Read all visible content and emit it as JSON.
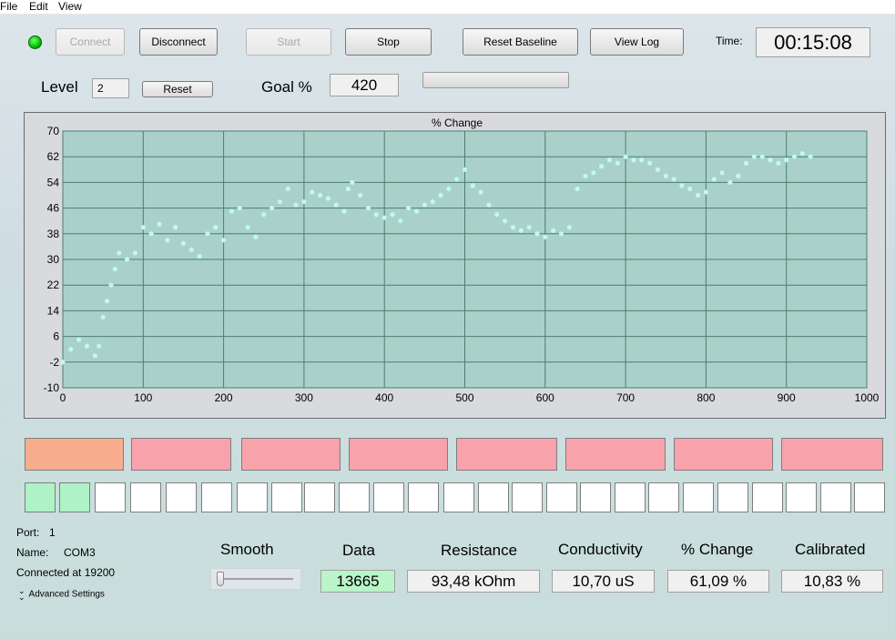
{
  "menu": {
    "file": "File",
    "edit": "Edit",
    "view": "View"
  },
  "toolbar": {
    "connect": "Connect",
    "disconnect": "Disconnect",
    "start": "Start",
    "stop": "Stop",
    "reset_baseline": "Reset Baseline",
    "view_log": "View Log",
    "time_label": "Time:",
    "time_value": "00:15:08"
  },
  "level": {
    "label": "Level",
    "value": "2",
    "reset": "Reset"
  },
  "goal": {
    "label": "Goal %",
    "value": "420",
    "progress": 0
  },
  "chart_data": {
    "type": "scatter",
    "title": "% Change",
    "xlabel": "",
    "ylabel": "",
    "xlim": [
      0,
      1000
    ],
    "ylim": [
      -10,
      70
    ],
    "x_ticks": [
      "0",
      "100",
      "200",
      "300",
      "400",
      "500",
      "600",
      "700",
      "800",
      "900",
      "1000"
    ],
    "y_ticks": [
      "70",
      "62",
      "54",
      "46",
      "38",
      "30",
      "22",
      "14",
      "6",
      "-2",
      "-10"
    ],
    "grid": true,
    "legend": "none",
    "series": [
      {
        "color": "#bff8f4",
        "x": [
          0,
          10,
          20,
          30,
          40,
          45,
          50,
          55,
          60,
          65,
          70,
          80,
          90,
          100,
          110,
          120,
          130,
          140,
          150,
          160,
          170,
          180,
          190,
          200,
          210,
          220,
          230,
          240,
          250,
          260,
          270,
          280,
          290,
          300,
          310,
          320,
          330,
          340,
          350,
          355,
          360,
          370,
          380,
          390,
          400,
          410,
          420,
          430,
          440,
          450,
          460,
          470,
          480,
          490,
          500,
          510,
          520,
          530,
          540,
          550,
          560,
          570,
          580,
          590,
          600,
          610,
          620,
          630,
          640,
          650,
          660,
          670,
          680,
          690,
          700,
          710,
          720,
          730,
          740,
          750,
          760,
          770,
          780,
          790,
          800,
          810,
          820,
          830,
          840,
          850,
          860,
          870,
          880,
          890,
          900,
          910,
          920,
          930
        ],
        "y": [
          -2,
          2,
          5,
          3,
          0,
          3,
          12,
          17,
          22,
          27,
          32,
          30,
          32,
          40,
          38,
          41,
          36,
          40,
          35,
          33,
          31,
          38,
          40,
          36,
          45,
          46,
          40,
          37,
          44,
          46,
          48,
          52,
          47,
          48,
          51,
          50,
          49,
          47,
          45,
          52,
          54,
          50,
          46,
          44,
          43,
          44,
          42,
          46,
          45,
          47,
          48,
          50,
          52,
          55,
          58,
          53,
          51,
          47,
          44,
          42,
          40,
          39,
          40,
          38,
          37,
          39,
          38,
          40,
          52,
          56,
          57,
          59,
          61,
          60,
          62,
          61,
          61,
          60,
          58,
          56,
          55,
          53,
          52,
          50,
          51,
          55,
          57,
          54,
          56,
          60,
          62,
          62,
          61,
          60,
          61,
          62,
          63,
          62
        ]
      }
    ]
  },
  "zones": [
    "",
    "",
    "",
    "",
    "",
    "",
    "",
    ""
  ],
  "device": {
    "port_label": "Port:",
    "port_value": "1",
    "name_label": "Name:",
    "name_value": "COM3",
    "connected": "Connected at 19200",
    "advanced": "Advanced Settings"
  },
  "smooth": {
    "label": "Smooth",
    "value": 0
  },
  "readouts": {
    "data_label": "Data",
    "data_value": "13665",
    "resistance_label": "Resistance",
    "resistance_value": "93,48 kOhm",
    "conductivity_label": "Conductivity",
    "conductivity_value": "10,70 uS",
    "change_label": "% Change",
    "change_value": "61,09 %",
    "calibrated_label": "Calibrated",
    "calibrated_value": "10,83 %"
  },
  "colors": {
    "plot_bg": "#a9d1c9",
    "grid": "#4c7f6f",
    "zone_active": "#f8ad8e",
    "zone_idle": "#f8a2ab",
    "cell_active": "#aef2c6",
    "data_field": "#b9f5c9"
  }
}
